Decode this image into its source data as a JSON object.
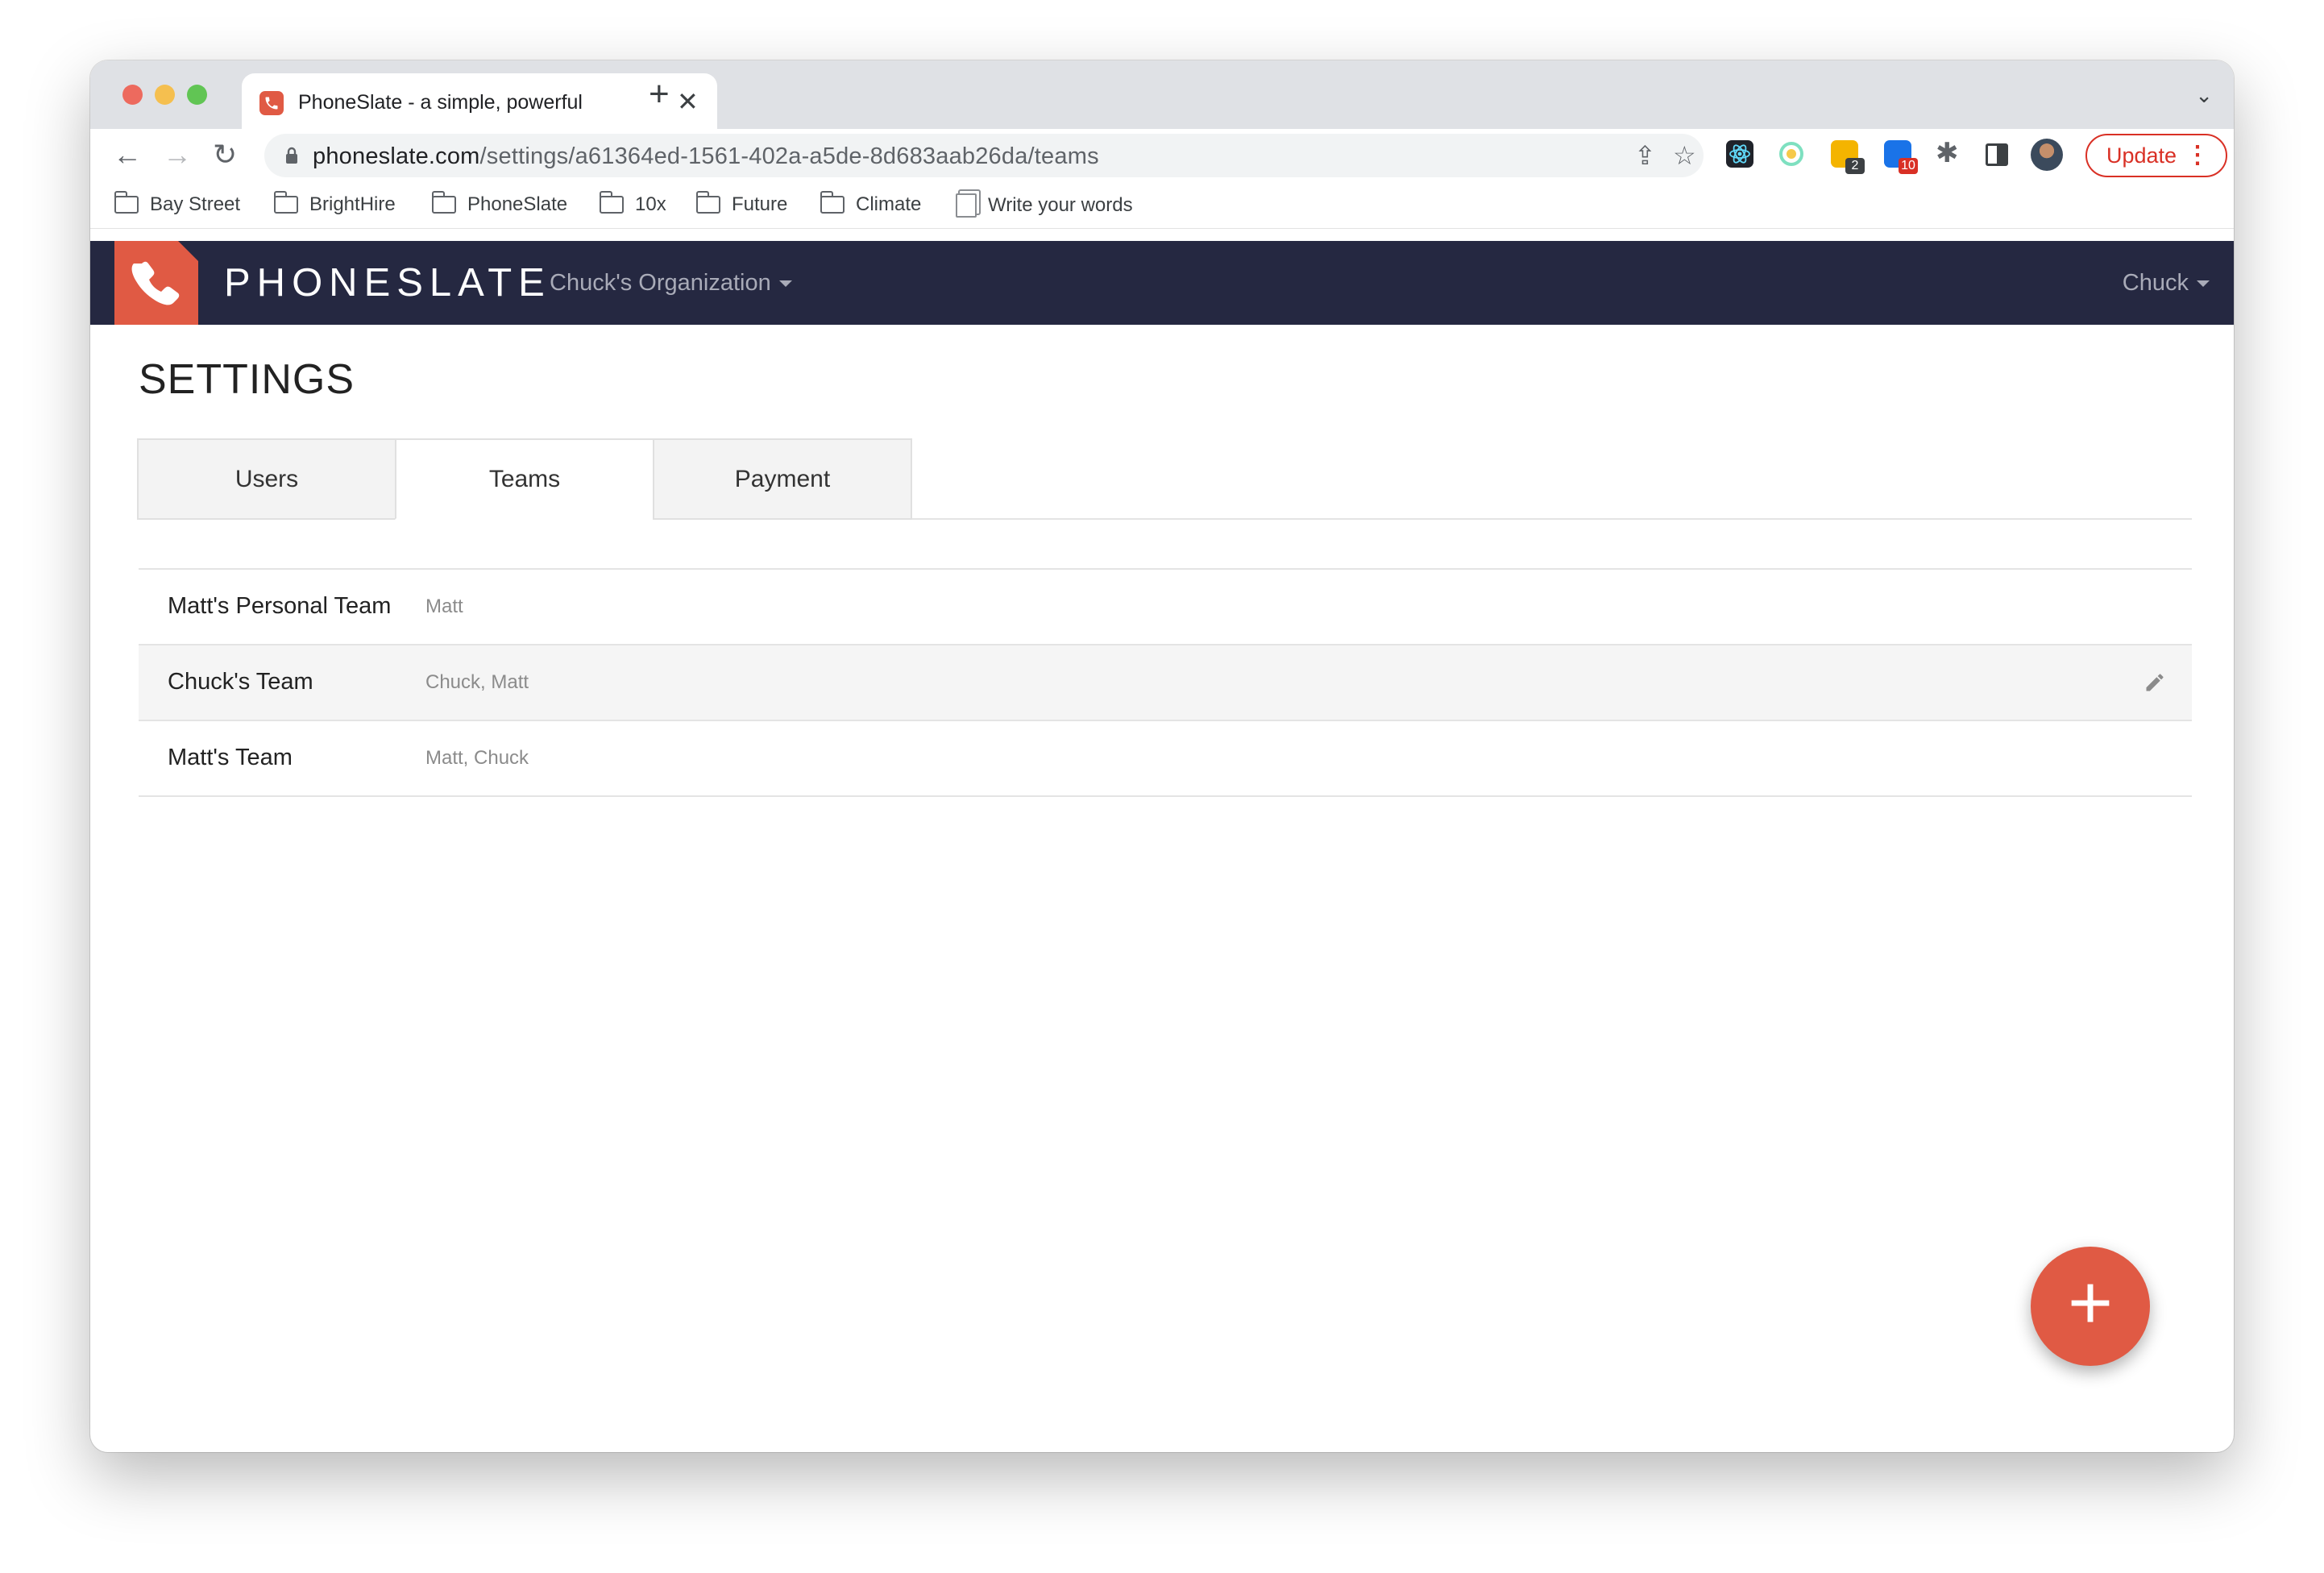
{
  "browser": {
    "tab_title": "PhoneSlate - a simple, powerful",
    "tab_close": "✕",
    "new_tab": "+",
    "url_host": "phoneslate.com",
    "url_path": "/settings/a61364ed-1561-402a-a5de-8d683aab26da/teams",
    "update_label": "Update",
    "extensions": [
      {
        "name": "react-devtools-icon",
        "color": "#20232a"
      },
      {
        "name": "color-picker-icon",
        "color": "#e8f5e9"
      },
      {
        "name": "sticky-notes-icon",
        "color": "#f4b400",
        "badge": "2",
        "badge_color": "#3c4043"
      },
      {
        "name": "checker-icon",
        "color": "#1a73e8",
        "badge": "10",
        "badge_color": "#d93025"
      }
    ]
  },
  "bookmarks": [
    {
      "label": "Bay Street",
      "icon": "folder-icon"
    },
    {
      "label": "BrightHire",
      "icon": "folder-icon"
    },
    {
      "label": "PhoneSlate",
      "icon": "folder-icon"
    },
    {
      "label": "10x",
      "icon": "folder-icon"
    },
    {
      "label": "Future",
      "icon": "folder-icon"
    },
    {
      "label": "Climate",
      "icon": "folder-icon"
    },
    {
      "label": "Write your words",
      "icon": "document-icon"
    }
  ],
  "app": {
    "brand": "PHONESLATE",
    "organization": "Chuck's Organization",
    "user": "Chuck",
    "accent_color": "#e05a44",
    "header_color": "#252841"
  },
  "settings": {
    "title": "SETTINGS",
    "tabs": [
      {
        "label": "Users",
        "active": false
      },
      {
        "label": "Teams",
        "active": true
      },
      {
        "label": "Payment",
        "active": false
      }
    ],
    "teams": [
      {
        "name": "Matt's Personal Team",
        "members": "Matt"
      },
      {
        "name": "Chuck's Team",
        "members": "Chuck, Matt"
      },
      {
        "name": "Matt's Team",
        "members": "Matt, Chuck"
      }
    ],
    "fab_label": "+"
  }
}
